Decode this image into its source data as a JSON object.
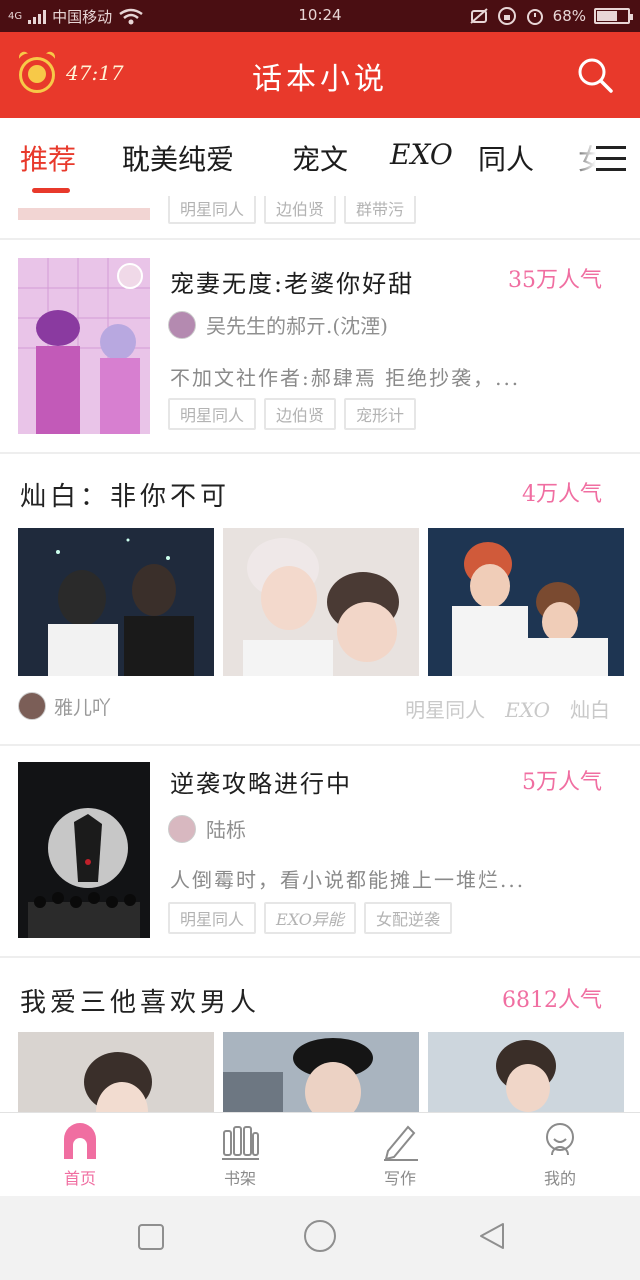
{
  "status_bar": {
    "network": "4G",
    "carrier": "中国移动",
    "time": "10:24",
    "battery": "68%",
    "battery_level": 0.68
  },
  "app_bar": {
    "timer": "47:17",
    "title": "话本小说",
    "icons": [
      "alarm-clock-coin-icon",
      "search-icon"
    ]
  },
  "tabs": {
    "items": [
      {
        "label": "推荐",
        "active": true
      },
      {
        "label": "耽美纯爱",
        "active": false
      },
      {
        "label": "宠文",
        "active": false
      },
      {
        "label": "EXO",
        "active": false
      },
      {
        "label": "同人",
        "active": false
      },
      {
        "label": "女",
        "active": false
      }
    ],
    "menu_icon": "menu-icon"
  },
  "feed": {
    "partial_card": {
      "tags": [
        "明星同人",
        "边伯贤",
        "群带污"
      ]
    },
    "book1": {
      "title": "宠妻无度:老婆你好甜",
      "popularity": "35万人气",
      "author": "吴先生的郝亓.(沈湮)",
      "description": "不加文社作者:郝肆焉 拒绝抄袭，...",
      "tags": [
        "明星同人",
        "边伯贤",
        "宠形计"
      ]
    },
    "topic1": {
      "title": "灿白：非你不可",
      "popularity": "4万人气",
      "author": "雅儿吖",
      "tags": [
        "明星同人",
        "EXO",
        "灿白"
      ]
    },
    "book2": {
      "title": "逆袭攻略进行中",
      "popularity": "5万人气",
      "author": "陆栎",
      "description": "人倒霉时，看小说都能摊上一堆烂...",
      "tags": [
        "明星同人",
        "EXO异能",
        "女配逆袭"
      ]
    },
    "topic2": {
      "title": "我爱三他喜欢男人",
      "popularity": "6812人气"
    }
  },
  "bottom_nav": {
    "items": [
      {
        "label": "首页",
        "icon": "home-icon",
        "active": true
      },
      {
        "label": "书架",
        "icon": "bookshelf-icon",
        "active": false
      },
      {
        "label": "写作",
        "icon": "pen-icon",
        "active": false
      },
      {
        "label": "我的",
        "icon": "profile-icon",
        "active": false
      }
    ]
  },
  "system_nav": {
    "icons": [
      "recent-apps-icon",
      "home-circle-icon",
      "back-triangle-icon"
    ]
  },
  "colors": {
    "brand_red": "#e8392b",
    "popularity_pink": "#f06ea1",
    "status_bar_bg": "#4a0e12"
  }
}
